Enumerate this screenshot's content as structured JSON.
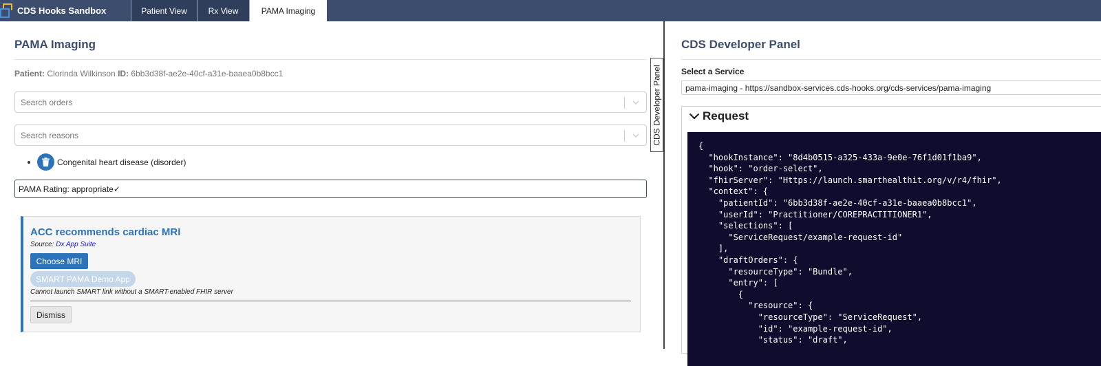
{
  "app": {
    "title": "CDS Hooks Sandbox"
  },
  "nav": {
    "tabs": [
      {
        "label": "Patient View"
      },
      {
        "label": "Rx View"
      },
      {
        "label": "PAMA Imaging"
      }
    ]
  },
  "left": {
    "title": "PAMA Imaging",
    "patient_label": "Patient:",
    "patient_name": "Clorinda Wilkinson",
    "id_label": "ID:",
    "patient_id": "6bb3d38f-ae2e-40cf-a31e-baaea0b8bcc1",
    "orders_placeholder": "Search orders",
    "reasons_placeholder": "Search reasons",
    "reason_item": "Congenital heart disease (disorder)",
    "rating": "PAMA Rating: appropriate✓",
    "card": {
      "title": "ACC recommends cardiac MRI",
      "source_label": "Source:",
      "source_link": "Dx App Suite",
      "choose_button": "Choose MRI",
      "smart_button": "SMART PAMA Demo App",
      "note": "Cannot launch SMART link without a SMART-enabled FHIR server",
      "dismiss_button": "Dismiss"
    },
    "dev_toggle": "CDS Developer Panel"
  },
  "right": {
    "title": "CDS Developer Panel",
    "service_label": "Select a Service",
    "service_value": "pama-imaging - https://sandbox-services.cds-hooks.org/cds-services/pama-imaging",
    "request_label": "Request",
    "request_code": "{\n  \"hookInstance\": \"8d4b0515-a325-433a-9e0e-76f1d01f1ba9\",\n  \"hook\": \"order-select\",\n  \"fhirServer\": \"Https://launch.smarthealthit.org/v/r4/fhir\",\n  \"context\": {\n    \"patientId\": \"6bb3d38f-ae2e-40cf-a31e-baaea0b8bcc1\",\n    \"userId\": \"Practitioner/COREPRACTITIONER1\",\n    \"selections\": [\n      \"ServiceRequest/example-request-id\"\n    ],\n    \"draftOrders\": {\n      \"resourceType\": \"Bundle\",\n      \"entry\": [\n        {\n          \"resource\": {\n            \"resourceType\": \"ServiceRequest\",\n            \"id\": \"example-request-id\",\n            \"status\": \"draft\","
  },
  "colors": {
    "nav": "#3c4d6e",
    "accent": "#2d73b9",
    "code_bg": "#0f0c2d"
  }
}
